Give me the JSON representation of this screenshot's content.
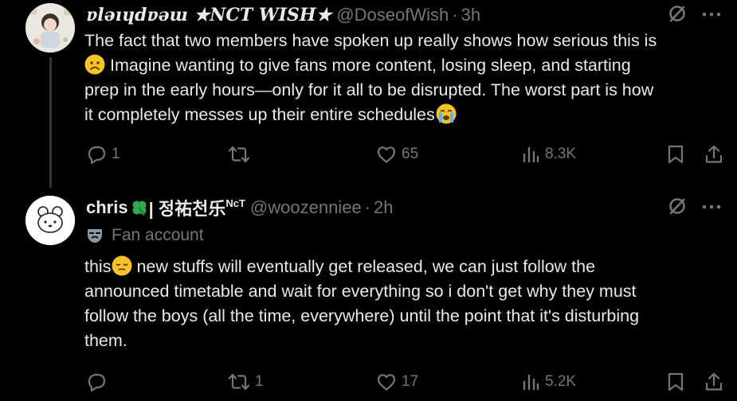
{
  "tweets": [
    {
      "author": {
        "display_name": "ɐlǝıɥdɐǝɯ ★NCT WISH★",
        "handle": "@DoseofWish",
        "time": "3h"
      },
      "lines": [
        "The fact that two members have spoken up really shows how serious this is",
        " Imagine wanting to give fans more content, losing sleep, and starting",
        "prep in the early hours—only for it all to be disrupted. The worst part is how",
        "it completely messes up their entire schedules"
      ],
      "stats": {
        "replies": "1",
        "reposts": "",
        "likes": "65",
        "views": "8.3K"
      }
    },
    {
      "author": {
        "display_name": "chris",
        "name_suffix": " | 정祐천乐",
        "name_tag": "NcT",
        "handle": "@woozenniee",
        "time": "2h"
      },
      "label": "Fan account",
      "lines": [
        " new stuffs will eventually get released, we can just follow the",
        "announced timetable and wait for everything so i don't get why they must",
        "follow the boys (all the time, everywhere) until the point that it's disturbing",
        "them."
      ],
      "line_prefix": "this",
      "stats": {
        "replies": "",
        "reposts": "1",
        "likes": "17",
        "views": "5.2K"
      }
    }
  ],
  "separator": "·",
  "icons": {
    "reply": "reply-icon",
    "repost": "repost-icon",
    "like": "heart-icon",
    "views": "views-icon",
    "bookmark": "bookmark-icon",
    "share": "share-icon",
    "grok": "grok-icon",
    "more": "more-icon",
    "fan": "fan-account-mask-icon"
  },
  "colors": {
    "background": "#000000",
    "text": "#e7e9ea",
    "muted": "#71767b",
    "clover": "#2fa84f"
  }
}
